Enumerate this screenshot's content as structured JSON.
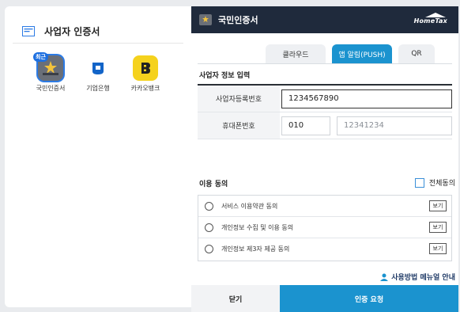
{
  "left_panel": {
    "title": "사업자 인증서",
    "apps": [
      {
        "label": "국민인증서",
        "badge": "최근",
        "icon": "kb-cert-icon"
      },
      {
        "label": "기업은행",
        "icon": "ibk-icon"
      },
      {
        "label": "카카오뱅크",
        "icon": "kakaobank-icon"
      }
    ]
  },
  "modal": {
    "title": "국민인증서",
    "brand_main": "HomeTax",
    "tabs": [
      {
        "label": "클라우드"
      },
      {
        "label": "앱 알림(PUSH)",
        "active": true
      },
      {
        "label": "QR"
      }
    ],
    "section_title": "사업자 정보 입력",
    "fields": {
      "biz_label": "사업자등록번호",
      "biz_value": "1234567890",
      "phone_label": "휴대폰번호",
      "phone_prefix": "010",
      "phone_value": "12341234"
    },
    "agree": {
      "title": "이용 동의",
      "all_label": "전체동의",
      "items": [
        {
          "label": "서비스 이용약관 동의",
          "view": "보기"
        },
        {
          "label": "개인정보 수집 및 이용 동의",
          "view": "보기"
        },
        {
          "label": "개인정보 제3자 제공 동의",
          "view": "보기"
        }
      ]
    },
    "manual_link": "사용방법 메뉴얼 안내",
    "footer": {
      "close_label": "닫기",
      "request_label": "인증 요청"
    }
  },
  "colors": {
    "header_bg": "#1f2a3c",
    "accent": "#1b93cf",
    "kakao_yellow": "#f5d21d"
  }
}
